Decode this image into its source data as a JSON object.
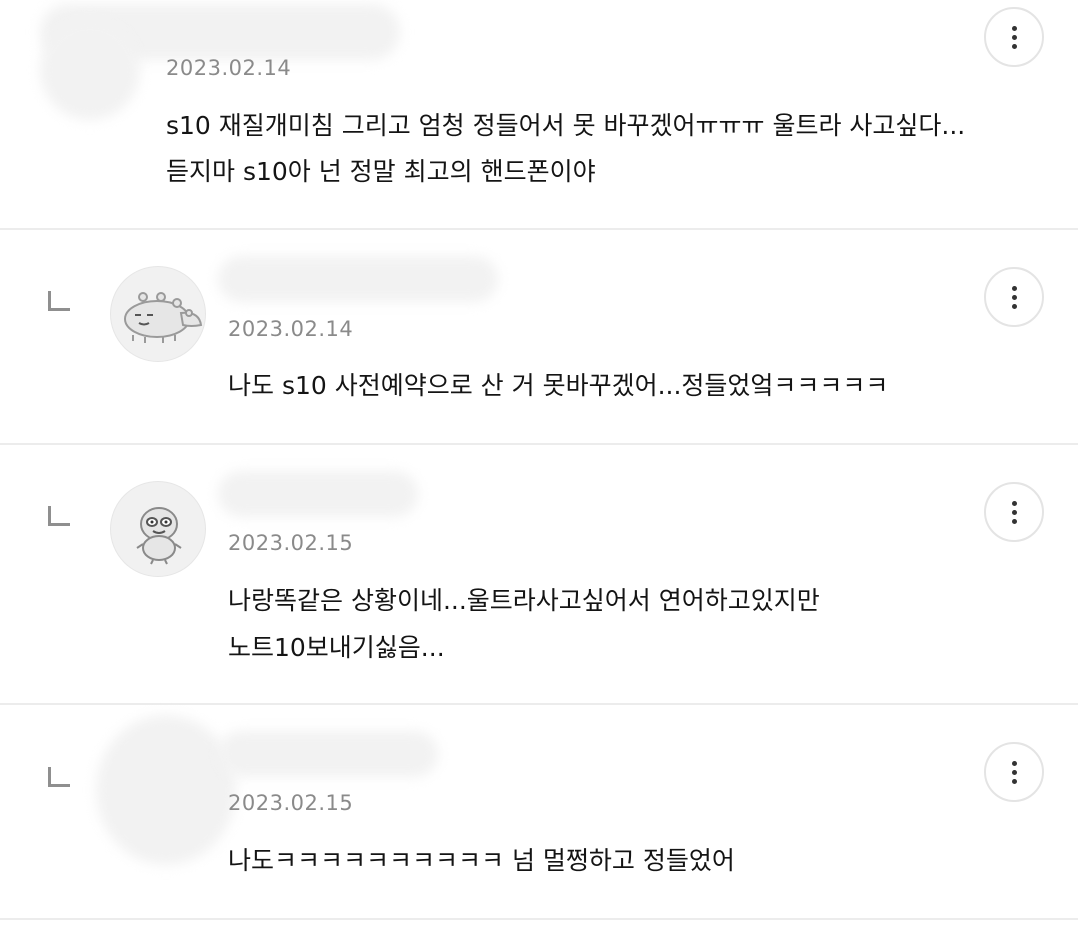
{
  "comments": [
    {
      "date": "2023.02.14",
      "lines": [
        "s10 재질개미침 그리고 엄청 정들어서 못 바꾸겠어ㅠㅠㅠ 울트라 사고싶다...",
        "듣지마 s10아 넌 정말 최고의 핸드폰이야"
      ],
      "avatar_icon": "none",
      "is_reply": false
    },
    {
      "date": "2023.02.14",
      "lines": [
        "나도 s10 사전예약으로 산 거 못바꾸겠어...정들었엌ㅋㅋㅋㅋㅋ"
      ],
      "avatar_icon": "dinosaur-avatar-icon",
      "is_reply": true
    },
    {
      "date": "2023.02.15",
      "lines": [
        "나랑똑같은 상황이네...울트라사고싶어서 연어하고있지만",
        "노트10보내기싫음..."
      ],
      "avatar_icon": "duck-avatar-icon",
      "is_reply": true
    },
    {
      "date": "2023.02.15",
      "lines": [
        "나도ㅋㅋㅋㅋㅋㅋㅋㅋㅋㅋ 넘 멀쩡하고 정들었어"
      ],
      "avatar_icon": "none",
      "is_reply": true
    }
  ],
  "icons": {
    "menu": "more-vertical-icon",
    "reply": "reply-corner-icon"
  },
  "colors": {
    "text": "#141414",
    "date": "#8a8a8a",
    "divider": "#ececec",
    "reply_mark": "#8f8f8f"
  }
}
